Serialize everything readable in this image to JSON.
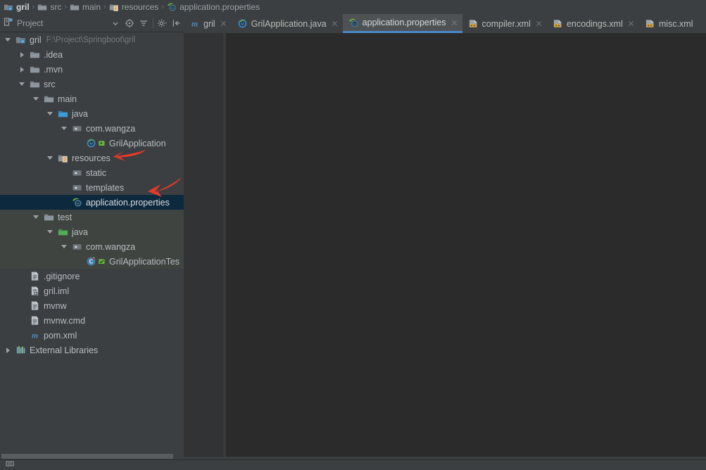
{
  "breadcrumb": {
    "items": [
      {
        "label": "gril",
        "icon": "project-module-icon",
        "root": true
      },
      {
        "label": "src",
        "icon": "folder-icon",
        "root": false
      },
      {
        "label": "main",
        "icon": "folder-icon",
        "root": false
      },
      {
        "label": "resources",
        "icon": "resources-folder-icon",
        "root": false
      },
      {
        "label": "application.properties",
        "icon": "spring-properties-icon",
        "root": false
      }
    ],
    "separator": "›"
  },
  "tool_window": {
    "title": "Project",
    "dropdown_icon": "chevron-down-icon",
    "buttons": [
      {
        "name": "locate-in-tree-button",
        "icon": "target-icon"
      },
      {
        "name": "collapse-all-button",
        "icon": "collapse-all-icon"
      },
      {
        "name": "settings-button",
        "icon": "gear-icon"
      },
      {
        "name": "hide-tool-window-button",
        "icon": "hide-panel-icon"
      }
    ]
  },
  "tabs": [
    {
      "label": "gril",
      "icon": "maven-icon",
      "active": false,
      "closable": true
    },
    {
      "label": "GrilApplication.java",
      "icon": "spring-boot-class-icon",
      "active": false,
      "closable": true
    },
    {
      "label": "application.properties",
      "icon": "spring-properties-icon",
      "active": true,
      "closable": true
    },
    {
      "label": "compiler.xml",
      "icon": "xml-icon",
      "active": false,
      "closable": true
    },
    {
      "label": "encodings.xml",
      "icon": "xml-icon",
      "active": false,
      "closable": true
    },
    {
      "label": "misc.xml",
      "icon": "xml-icon",
      "active": false,
      "closable": false
    }
  ],
  "tree": {
    "rows": [
      {
        "label": "gril",
        "path": "F:\\Project\\Springboot\\gril",
        "indent": 0,
        "twisty": "expanded",
        "icon": "project-module-icon",
        "selected": false,
        "scope": "none",
        "badge": "none"
      },
      {
        "label": ".idea",
        "path": "",
        "indent": 1,
        "twisty": "collapsed",
        "icon": "folder-icon",
        "selected": false,
        "scope": "none",
        "badge": "none"
      },
      {
        "label": ".mvn",
        "path": "",
        "indent": 1,
        "twisty": "collapsed",
        "icon": "folder-icon",
        "selected": false,
        "scope": "none",
        "badge": "none"
      },
      {
        "label": "src",
        "path": "",
        "indent": 1,
        "twisty": "expanded",
        "icon": "folder-icon",
        "selected": false,
        "scope": "none",
        "badge": "none"
      },
      {
        "label": "main",
        "path": "",
        "indent": 2,
        "twisty": "expanded",
        "icon": "folder-icon",
        "selected": false,
        "scope": "none",
        "badge": "none"
      },
      {
        "label": "java",
        "path": "",
        "indent": 3,
        "twisty": "expanded",
        "icon": "source-root-icon",
        "selected": false,
        "scope": "none",
        "badge": "none"
      },
      {
        "label": "com.wangza",
        "path": "",
        "indent": 4,
        "twisty": "expanded",
        "icon": "package-icon",
        "selected": false,
        "scope": "none",
        "badge": "none"
      },
      {
        "label": "GrilApplication",
        "path": "",
        "indent": 5,
        "twisty": "none",
        "icon": "spring-boot-class-icon",
        "selected": false,
        "scope": "none",
        "badge": "run-marker"
      },
      {
        "label": "resources",
        "path": "",
        "indent": 3,
        "twisty": "expanded",
        "icon": "resources-root-icon",
        "selected": false,
        "scope": "none",
        "badge": "none"
      },
      {
        "label": "static",
        "path": "",
        "indent": 4,
        "twisty": "none",
        "icon": "package-icon",
        "selected": false,
        "scope": "none",
        "badge": "none"
      },
      {
        "label": "templates",
        "path": "",
        "indent": 4,
        "twisty": "none",
        "icon": "package-icon",
        "selected": false,
        "scope": "none",
        "badge": "none"
      },
      {
        "label": "application.properties",
        "path": "",
        "indent": 4,
        "twisty": "none",
        "icon": "spring-properties-icon",
        "selected": true,
        "scope": "none",
        "badge": "none"
      },
      {
        "label": "test",
        "path": "",
        "indent": 2,
        "twisty": "expanded",
        "icon": "folder-icon",
        "selected": false,
        "scope": "test",
        "badge": "none"
      },
      {
        "label": "java",
        "path": "",
        "indent": 3,
        "twisty": "expanded",
        "icon": "test-root-icon",
        "selected": false,
        "scope": "test",
        "badge": "none"
      },
      {
        "label": "com.wangza",
        "path": "",
        "indent": 4,
        "twisty": "expanded",
        "icon": "package-icon",
        "selected": false,
        "scope": "test",
        "badge": "none"
      },
      {
        "label": "GrilApplicationTes",
        "path": "",
        "indent": 5,
        "twisty": "none",
        "icon": "class-icon",
        "selected": false,
        "scope": "test",
        "badge": "test-marker"
      },
      {
        "label": ".gitignore",
        "path": "",
        "indent": 1,
        "twisty": "none",
        "icon": "text-file-icon",
        "selected": false,
        "scope": "none",
        "badge": "none"
      },
      {
        "label": "gril.iml",
        "path": "",
        "indent": 1,
        "twisty": "none",
        "icon": "iml-file-icon",
        "selected": false,
        "scope": "none",
        "badge": "none"
      },
      {
        "label": "mvnw",
        "path": "",
        "indent": 1,
        "twisty": "none",
        "icon": "text-file-icon",
        "selected": false,
        "scope": "none",
        "badge": "none"
      },
      {
        "label": "mvnw.cmd",
        "path": "",
        "indent": 1,
        "twisty": "none",
        "icon": "text-file-icon",
        "selected": false,
        "scope": "none",
        "badge": "none"
      },
      {
        "label": "pom.xml",
        "path": "",
        "indent": 1,
        "twisty": "none",
        "icon": "maven-icon",
        "selected": false,
        "scope": "none",
        "badge": "none"
      },
      {
        "label": "External Libraries",
        "path": "",
        "indent": 0,
        "twisty": "collapsed",
        "icon": "libraries-icon",
        "selected": false,
        "scope": "none",
        "badge": "none"
      }
    ]
  },
  "annotations": [
    {
      "name": "arrow-pointing-to-resources",
      "target": "resources",
      "color": "#e8392b"
    },
    {
      "name": "arrow-pointing-to-application-properties",
      "target": "application.properties",
      "color": "#e8392b"
    }
  ],
  "colors": {
    "panel_background": "#3c3f41",
    "editor_background": "#2b2b2b",
    "gutter_background": "#313335",
    "selection_background": "#0d293e",
    "test_scope_background": "#3f4440",
    "active_tab_background": "#4e5254",
    "active_tab_underline": "#4a88c7",
    "text_primary": "#b7bdc2",
    "text_dim": "#73797e",
    "annotation_red": "#e8392b"
  }
}
